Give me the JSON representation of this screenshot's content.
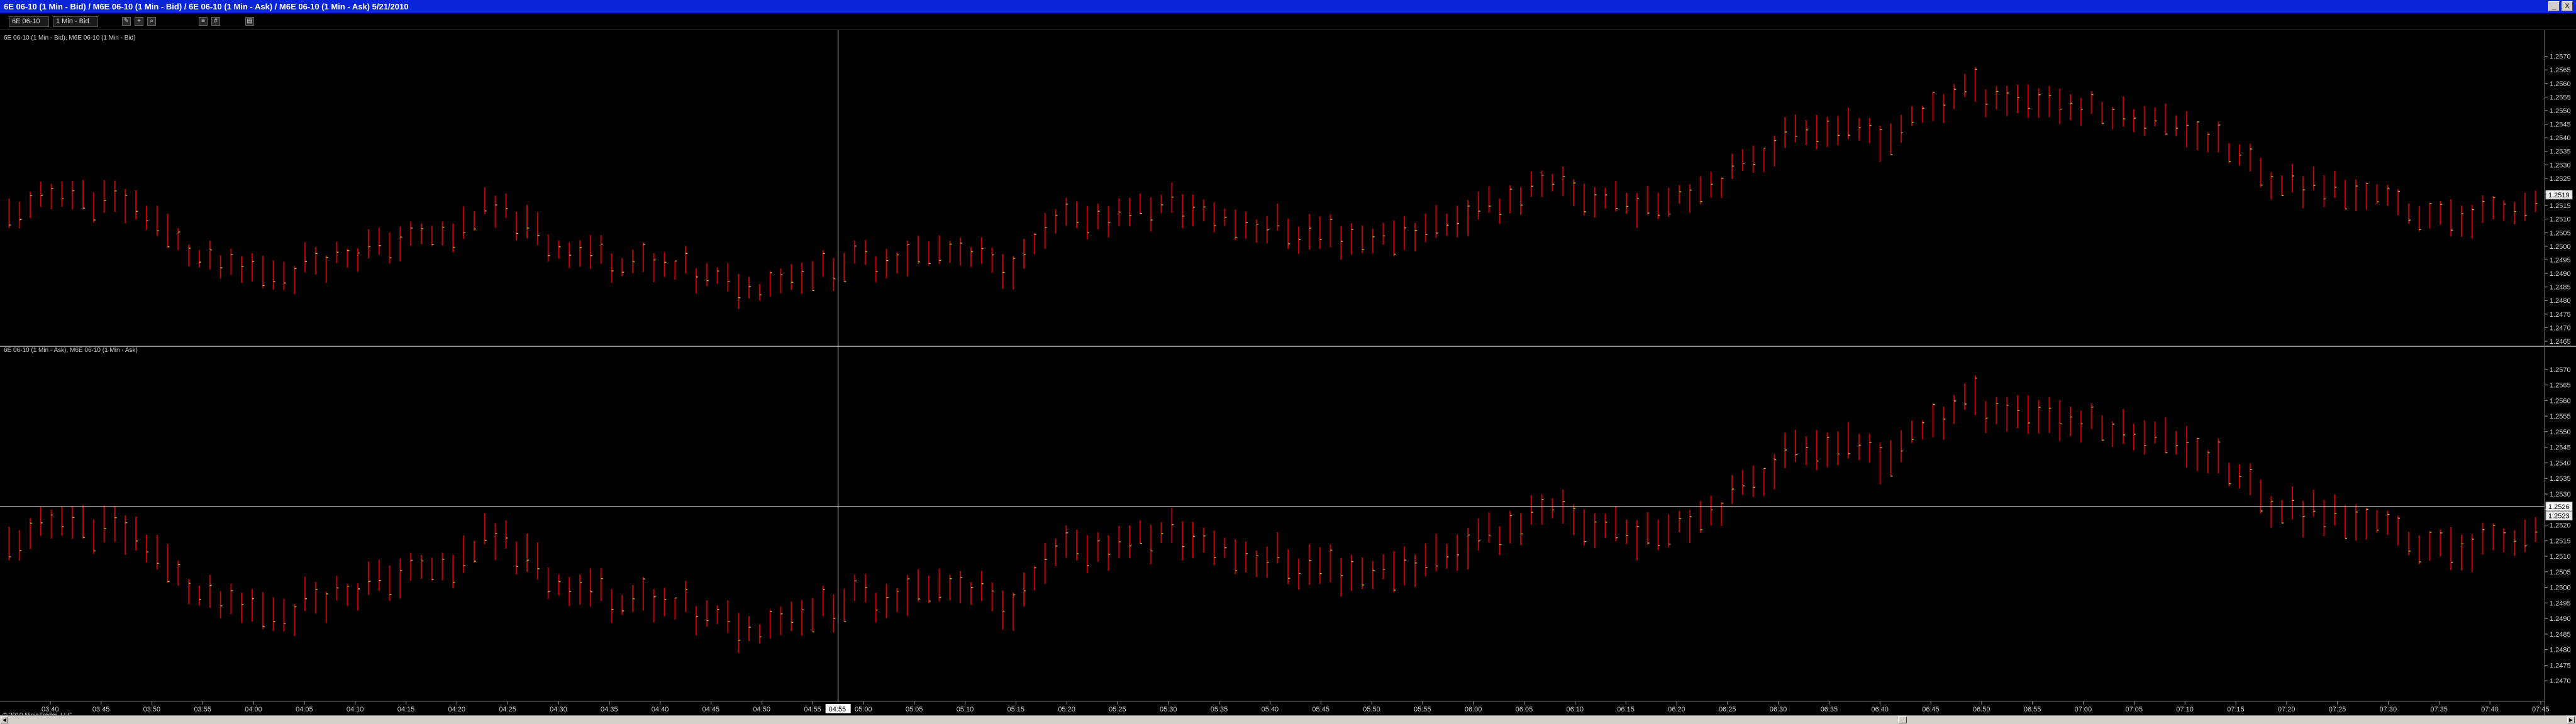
{
  "window": {
    "title": "6E 06-10 (1 Min - Bid) / M6E 06-10 (1 Min - Bid) / 6E 06-10 (1 Min - Ask) / M6E 06-10 (1 Min - Ask)  5/21/2010",
    "minimize_label": "_",
    "close_label": "X"
  },
  "toolbar": {
    "instrument": "6E 06-10",
    "interval": "1 Min - Bid",
    "icons": [
      "pencil-icon",
      "crosshair-icon",
      "zoom-icon",
      "properties-icon",
      "grid-icon",
      "print-icon"
    ]
  },
  "panels": [
    {
      "label": "6E 06-10 (1 Min - Bid), M6E 06-10 (1 Min - Bid)",
      "price_min": 1.2465,
      "price_max": 1.2575,
      "ticks": [
        "1.2570",
        "1.2565",
        "1.2560",
        "1.2555",
        "1.2550",
        "1.2545",
        "1.2540",
        "1.2535",
        "1.2530",
        "1.2525",
        "1.2520",
        "1.2515",
        "1.2510",
        "1.2505",
        "1.2500",
        "1.2495",
        "1.2490",
        "1.2485",
        "1.2480",
        "1.2475",
        "1.2470",
        "1.2465"
      ],
      "last_price": "1.2519"
    },
    {
      "label": "6E 06-10 (1 Min - Ask), M6E 06-10 (1 Min - Ask)",
      "price_min": 1.2465,
      "price_max": 1.2575,
      "ticks": [
        "1.2570",
        "1.2565",
        "1.2560",
        "1.2555",
        "1.2550",
        "1.2545",
        "1.2540",
        "1.2535",
        "1.2530",
        "1.2525",
        "1.2520",
        "1.2515",
        "1.2510",
        "1.2505",
        "1.2500",
        "1.2495",
        "1.2490",
        "1.2485",
        "1.2480",
        "1.2475",
        "1.2470"
      ],
      "last_price": "1.2523",
      "crosshair_price": "1.2526"
    }
  ],
  "time_axis": {
    "labels": [
      "03:40",
      "03:45",
      "03:50",
      "03:55",
      "04:00",
      "04:05",
      "04:10",
      "04:15",
      "04:20",
      "04:25",
      "04:30",
      "04:35",
      "04:40",
      "04:45",
      "04:50",
      "04:55",
      "05:00",
      "05:05",
      "05:10",
      "05:15",
      "05:20",
      "05:25",
      "05:30",
      "05:35",
      "05:40",
      "05:45",
      "05:50",
      "05:55",
      "06:00",
      "06:05",
      "06:10",
      "06:15",
      "06:20",
      "06:25",
      "06:30",
      "06:35",
      "06:40",
      "06:45",
      "06:50",
      "06:55",
      "07:00",
      "07:05",
      "07:10",
      "07:15",
      "07:20",
      "07:25",
      "07:30",
      "07:35",
      "07:40",
      "07:45"
    ],
    "crosshair_time": "04:55"
  },
  "copyright": "© 2010 NinjaTrader, LLC",
  "colors": {
    "bar": "#c40000",
    "close_tick": "#9acd32",
    "axis_text": "#d0d0d0",
    "crosshair": "#e0e0e0"
  }
}
